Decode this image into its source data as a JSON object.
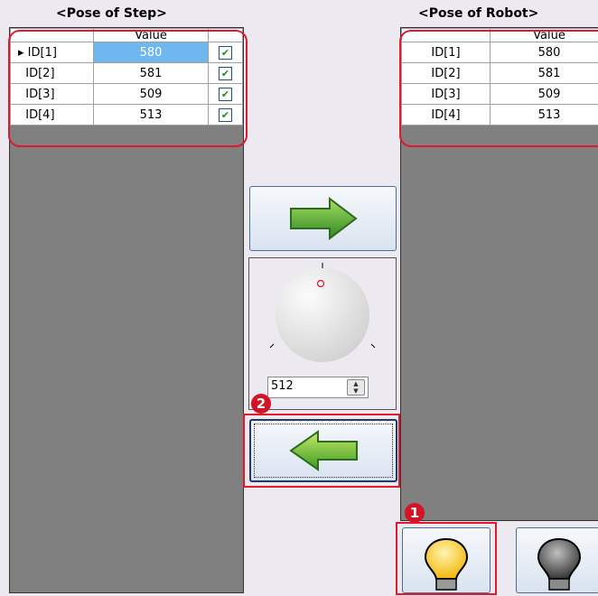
{
  "step_panel": {
    "title": "<Pose of Step>",
    "header_value": "Value",
    "rows": [
      {
        "id": "ID[1]",
        "value": "580",
        "checked": true
      },
      {
        "id": "ID[2]",
        "value": "581",
        "checked": true
      },
      {
        "id": "ID[3]",
        "value": "509",
        "checked": true
      },
      {
        "id": "ID[4]",
        "value": "513",
        "checked": true
      }
    ]
  },
  "robot_panel": {
    "title": "<Pose of Robot>",
    "header_value": "Value",
    "rows": [
      {
        "id": "ID[1]",
        "value": "580"
      },
      {
        "id": "ID[2]",
        "value": "581"
      },
      {
        "id": "ID[3]",
        "value": "509"
      },
      {
        "id": "ID[4]",
        "value": "513"
      }
    ]
  },
  "knob": {
    "value": "512"
  },
  "badges": {
    "one": "1",
    "two": "2"
  },
  "colors": {
    "highlight": "#e0192c",
    "arrow_green": "#3fa32c",
    "bulb_on": "#f7c21a",
    "bulb_off": "#5a5a5a"
  },
  "icons": {
    "send_to_robot": "arrow-right-icon",
    "get_from_robot": "arrow-left-icon",
    "torque_on": "lightbulb-on-icon",
    "torque_off": "lightbulb-off-icon"
  }
}
